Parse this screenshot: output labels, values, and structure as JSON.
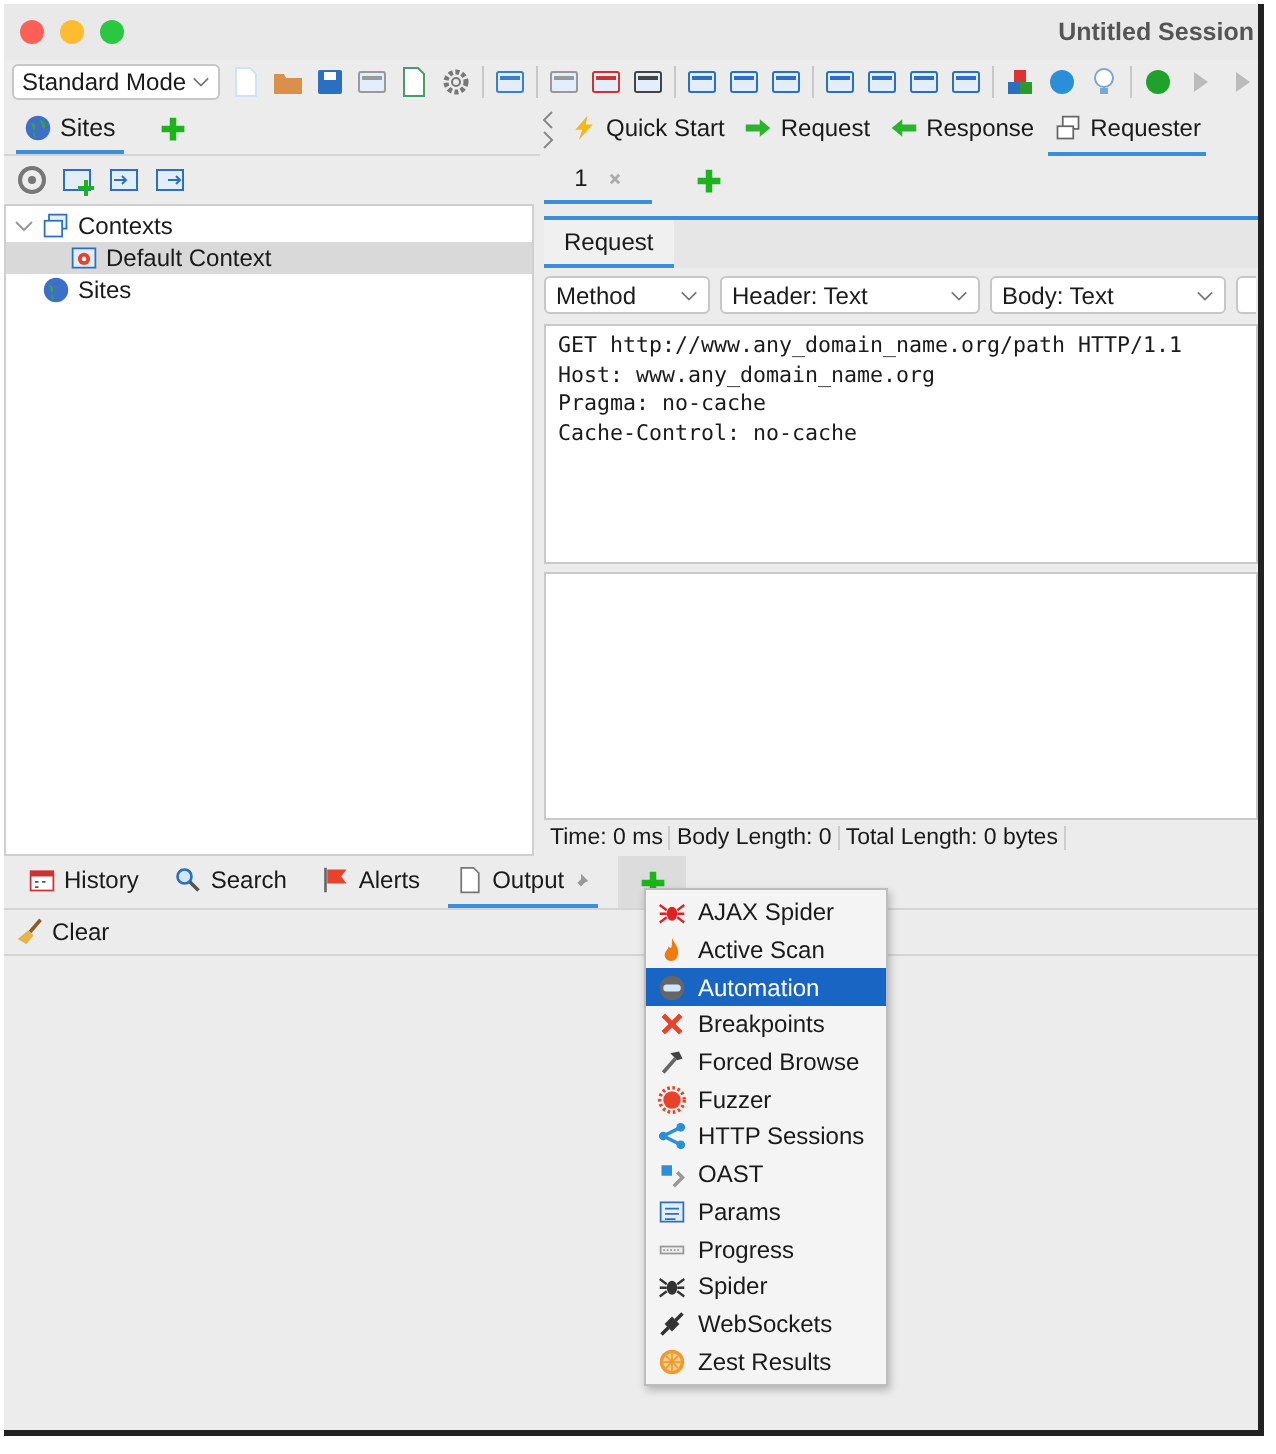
{
  "window": {
    "title": "Untitled Session"
  },
  "toolbar": {
    "mode": "Standard Mode"
  },
  "left_tabs": [
    {
      "label": "Sites",
      "selected": true
    }
  ],
  "tree": [
    {
      "label": "Contexts",
      "expanded": true,
      "selected": false,
      "children": [
        {
          "label": "Default Context",
          "selected": true
        }
      ]
    },
    {
      "label": "Sites",
      "selected": false
    }
  ],
  "right_tabs": [
    {
      "label": "Quick Start",
      "selected": false
    },
    {
      "label": "Request",
      "selected": false
    },
    {
      "label": "Response",
      "selected": false
    },
    {
      "label": "Requester",
      "selected": true
    }
  ],
  "requester_tabs": [
    {
      "label": "1",
      "selected": true
    }
  ],
  "request_tabs": [
    {
      "label": "Request",
      "selected": true
    }
  ],
  "dropdowns": [
    "Method",
    "Header: Text",
    "Body: Text"
  ],
  "request_text": [
    "GET http://www.any_domain_name.org/path HTTP/1.1",
    "Host: www.any_domain_name.org",
    "Pragma: no-cache",
    "Cache-Control: no-cache"
  ],
  "status_bar": [
    "Time: 0 ms",
    "Body Length: 0",
    "Total Length: 0 bytes"
  ],
  "bottom_tabs": [
    {
      "label": "History",
      "selected": false
    },
    {
      "label": "Search",
      "selected": false
    },
    {
      "label": "Alerts",
      "selected": false
    },
    {
      "label": "Output",
      "selected": true
    }
  ],
  "clear_button": "Clear",
  "add_menu": [
    {
      "label": "AJAX Spider",
      "selected": false
    },
    {
      "label": "Active Scan",
      "selected": false
    },
    {
      "label": "Automation",
      "selected": true
    },
    {
      "label": "Breakpoints",
      "selected": false
    },
    {
      "label": "Forced Browse",
      "selected": false
    },
    {
      "label": "Fuzzer",
      "selected": false
    },
    {
      "label": "HTTP Sessions",
      "selected": false
    },
    {
      "label": "OAST",
      "selected": false
    },
    {
      "label": "Params",
      "selected": false
    },
    {
      "label": "Progress",
      "selected": false
    },
    {
      "label": "Spider",
      "selected": false
    },
    {
      "label": "WebSockets",
      "selected": false
    },
    {
      "label": "Zest Results",
      "selected": false
    }
  ]
}
